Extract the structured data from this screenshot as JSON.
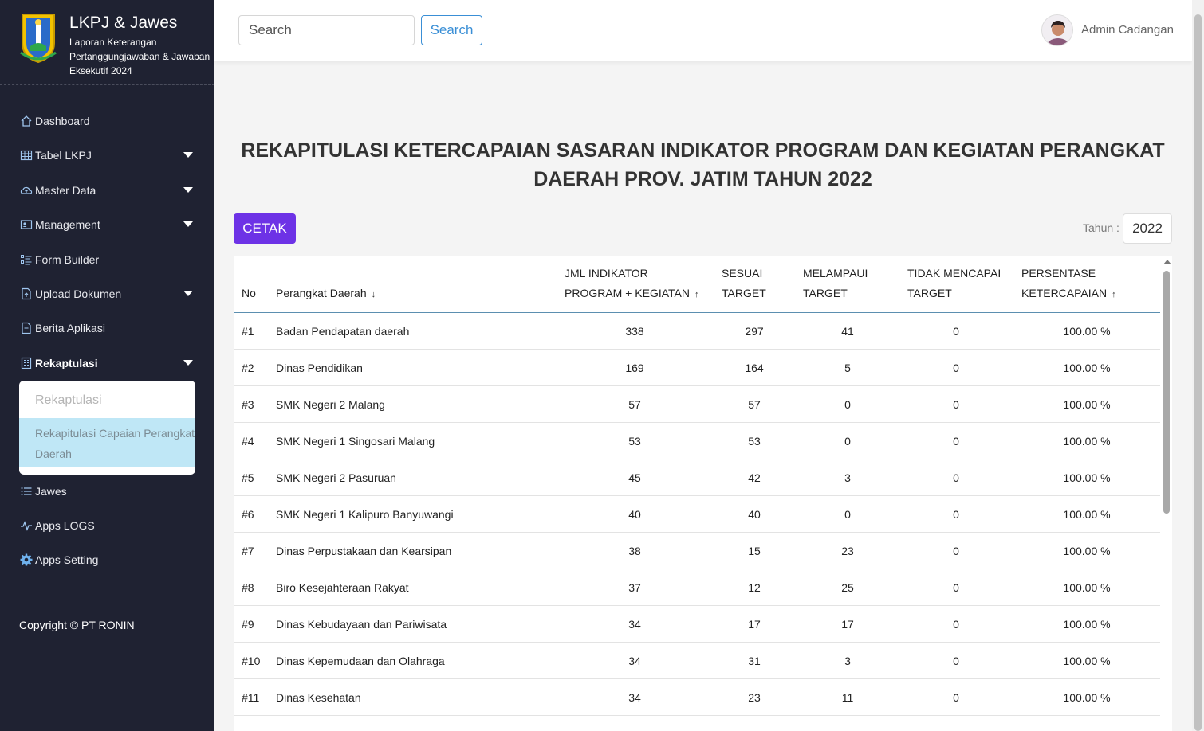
{
  "app": {
    "title": "LKPJ & Jawes",
    "subtitle": "Laporan Keterangan Pertanggungjawaban & Jawaban Eksekutif 2024"
  },
  "sidebar": {
    "items": [
      {
        "label": "Dashboard",
        "icon": "home-icon",
        "has_caret": false
      },
      {
        "label": "Tabel LKPJ",
        "icon": "table-icon",
        "has_caret": true
      },
      {
        "label": "Master Data",
        "icon": "cloud-upload-icon",
        "has_caret": true
      },
      {
        "label": "Management",
        "icon": "id-card-icon",
        "has_caret": true
      },
      {
        "label": "Form Builder",
        "icon": "form-list-icon",
        "has_caret": false
      },
      {
        "label": "Upload Dokumen",
        "icon": "file-upload-icon",
        "has_caret": true
      },
      {
        "label": "Berita Aplikasi",
        "icon": "document-icon",
        "has_caret": false
      },
      {
        "label": "Rekaptulasi",
        "icon": "building-icon",
        "has_caret": true
      },
      {
        "label": "Jawes",
        "icon": "list-icon",
        "has_caret": false
      },
      {
        "label": "Apps LOGS",
        "icon": "activity-icon",
        "has_caret": false
      },
      {
        "label": "Apps Setting",
        "icon": "gear-icon",
        "has_caret": false
      }
    ],
    "submenu": {
      "header": "Rekaptulasi",
      "active_link": "Rekapitulasi Capaian Perangkat Daerah"
    },
    "copyright": "Copyright © PT RONIN"
  },
  "topbar": {
    "search_placeholder": "Search",
    "search_button": "Search",
    "user_name": "Admin Cadangan"
  },
  "main": {
    "title": "REKAPITULASI KETERCAPAIAN SASARAN INDIKATOR PROGRAM DAN KEGIATAN PERANGKAT DAERAH PROV. JATIM TAHUN 2022",
    "print_button": "CETAK",
    "year_label": "Tahun :",
    "year_value": "2022"
  },
  "table": {
    "headers": {
      "no": "No",
      "perangkat": "Perangkat Daerah",
      "jml_line1": "JML INDIKATOR",
      "jml_line2": "PROGRAM + KEGIATAN",
      "sesuai_line1": "SESUAI",
      "sesuai_line2": "TARGET",
      "melampaui_line1": "MELAMPAUI",
      "melampaui_line2": "TARGET",
      "tidak_line1": "TIDAK MENCAPAI",
      "tidak_line2": "TARGET",
      "persen_line1": "PERSENTASE",
      "persen_line2": "KETERCAPAIAN"
    },
    "sort_icons": {
      "perangkat": "↓",
      "jml": "↑",
      "persen": "↑"
    },
    "rows": [
      {
        "no": "#1",
        "name": "Badan Pendapatan daerah",
        "jml": "338",
        "sesuai": "297",
        "melampaui": "41",
        "tidak": "0",
        "persen": "100.00 %"
      },
      {
        "no": "#2",
        "name": "Dinas Pendidikan",
        "jml": "169",
        "sesuai": "164",
        "melampaui": "5",
        "tidak": "0",
        "persen": "100.00 %"
      },
      {
        "no": "#3",
        "name": "SMK Negeri 2 Malang",
        "jml": "57",
        "sesuai": "57",
        "melampaui": "0",
        "tidak": "0",
        "persen": "100.00 %"
      },
      {
        "no": "#4",
        "name": "SMK Negeri 1 Singosari Malang",
        "jml": "53",
        "sesuai": "53",
        "melampaui": "0",
        "tidak": "0",
        "persen": "100.00 %"
      },
      {
        "no": "#5",
        "name": "SMK Negeri 2 Pasuruan",
        "jml": "45",
        "sesuai": "42",
        "melampaui": "3",
        "tidak": "0",
        "persen": "100.00 %"
      },
      {
        "no": "#6",
        "name": "SMK Negeri 1 Kalipuro Banyuwangi",
        "jml": "40",
        "sesuai": "40",
        "melampaui": "0",
        "tidak": "0",
        "persen": "100.00 %"
      },
      {
        "no": "#7",
        "name": "Dinas Perpustakaan dan Kearsipan",
        "jml": "38",
        "sesuai": "15",
        "melampaui": "23",
        "tidak": "0",
        "persen": "100.00 %"
      },
      {
        "no": "#8",
        "name": "Biro Kesejahteraan Rakyat",
        "jml": "37",
        "sesuai": "12",
        "melampaui": "25",
        "tidak": "0",
        "persen": "100.00 %"
      },
      {
        "no": "#9",
        "name": "Dinas Kebudayaan dan Pariwisata",
        "jml": "34",
        "sesuai": "17",
        "melampaui": "17",
        "tidak": "0",
        "persen": "100.00 %"
      },
      {
        "no": "#10",
        "name": "Dinas Kepemudaan dan Olahraga",
        "jml": "34",
        "sesuai": "31",
        "melampaui": "3",
        "tidak": "0",
        "persen": "100.00 %"
      },
      {
        "no": "#11",
        "name": "Dinas Kesehatan",
        "jml": "34",
        "sesuai": "23",
        "melampaui": "11",
        "tidak": "0",
        "persen": "100.00 %"
      }
    ]
  },
  "colors": {
    "sidebar_bg": "#1f2232",
    "accent_purple": "#6d32e6",
    "search_blue": "#3a8fd6",
    "submenu_active_bg": "#bfe7f6"
  }
}
